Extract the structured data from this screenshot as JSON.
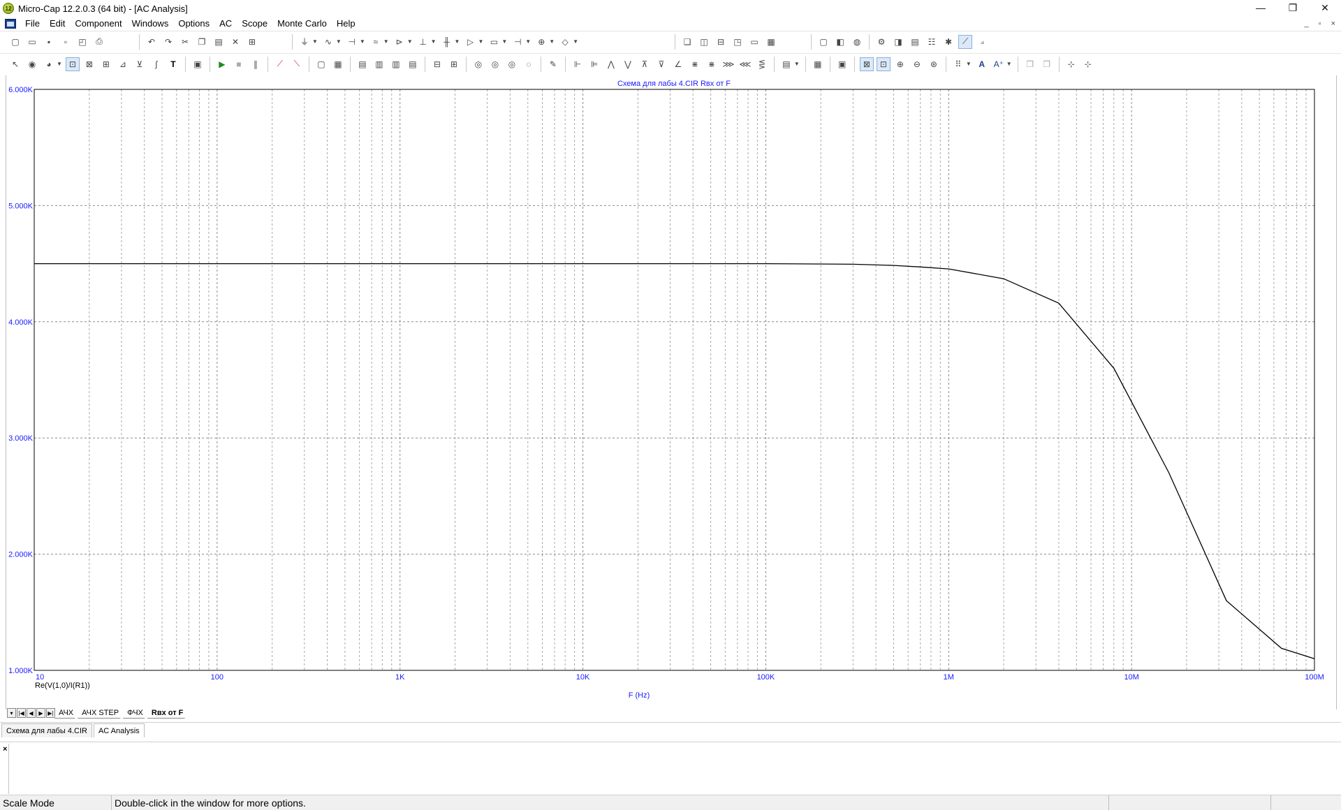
{
  "window": {
    "title": "Micro-Cap 12.2.0.3 (64 bit) - [AC Analysis]",
    "app_icon_text": "12",
    "controls": [
      "—",
      "❐",
      "✕"
    ]
  },
  "menu": {
    "items": [
      "File",
      "Edit",
      "Component",
      "Windows",
      "Options",
      "AC",
      "Scope",
      "Monte Carlo",
      "Help"
    ],
    "mdi_controls": [
      "_",
      "▫",
      "×"
    ]
  },
  "plot": {
    "title": "Схема для лабы 4.CIR Rвх от F",
    "x_label": "F (Hz)",
    "y_expression": "Re(V(1,0)/I(R1))",
    "accent_color": "#1a1aff"
  },
  "chart_data": {
    "type": "line",
    "x_scale": "log",
    "xlim": [
      10,
      100000000
    ],
    "ylim": [
      1000,
      6000
    ],
    "x_tick_labels": [
      "10",
      "100",
      "1K",
      "10K",
      "100K",
      "1M",
      "10M",
      "100M"
    ],
    "y_tick_labels": [
      "1.000K",
      "2.000K",
      "3.000K",
      "4.000K",
      "5.000K",
      "6.000K"
    ],
    "y_ticks": [
      1000,
      2000,
      3000,
      4000,
      5000,
      6000
    ],
    "grid": true,
    "series": [
      {
        "x": [
          10,
          100,
          1000,
          10000,
          100000,
          300000,
          500000,
          700000,
          1000000,
          2000000,
          4000000,
          8000000,
          16000000,
          33000000,
          66000000,
          100000000
        ],
        "y": [
          4500,
          4500,
          4500,
          4500,
          4500,
          4495,
          4485,
          4472,
          4455,
          4370,
          4160,
          3600,
          2700,
          1600,
          1190,
          1100
        ],
        "color": "#000000"
      }
    ]
  },
  "page_tabs": {
    "nav": [
      "▾",
      "|◀",
      "◀",
      "▶",
      "▶|"
    ],
    "tabs": [
      "АЧХ",
      "АЧХ STEP",
      "ФЧХ",
      "Rвх от F"
    ],
    "active": 3
  },
  "file_tabs": {
    "tabs": [
      "Схема для лабы 4.CIR",
      "AC Analysis"
    ],
    "active": 1
  },
  "output": {
    "close_label": "×"
  },
  "status": {
    "mode": "Scale Mode",
    "message": "Double-click in the window for more options."
  }
}
